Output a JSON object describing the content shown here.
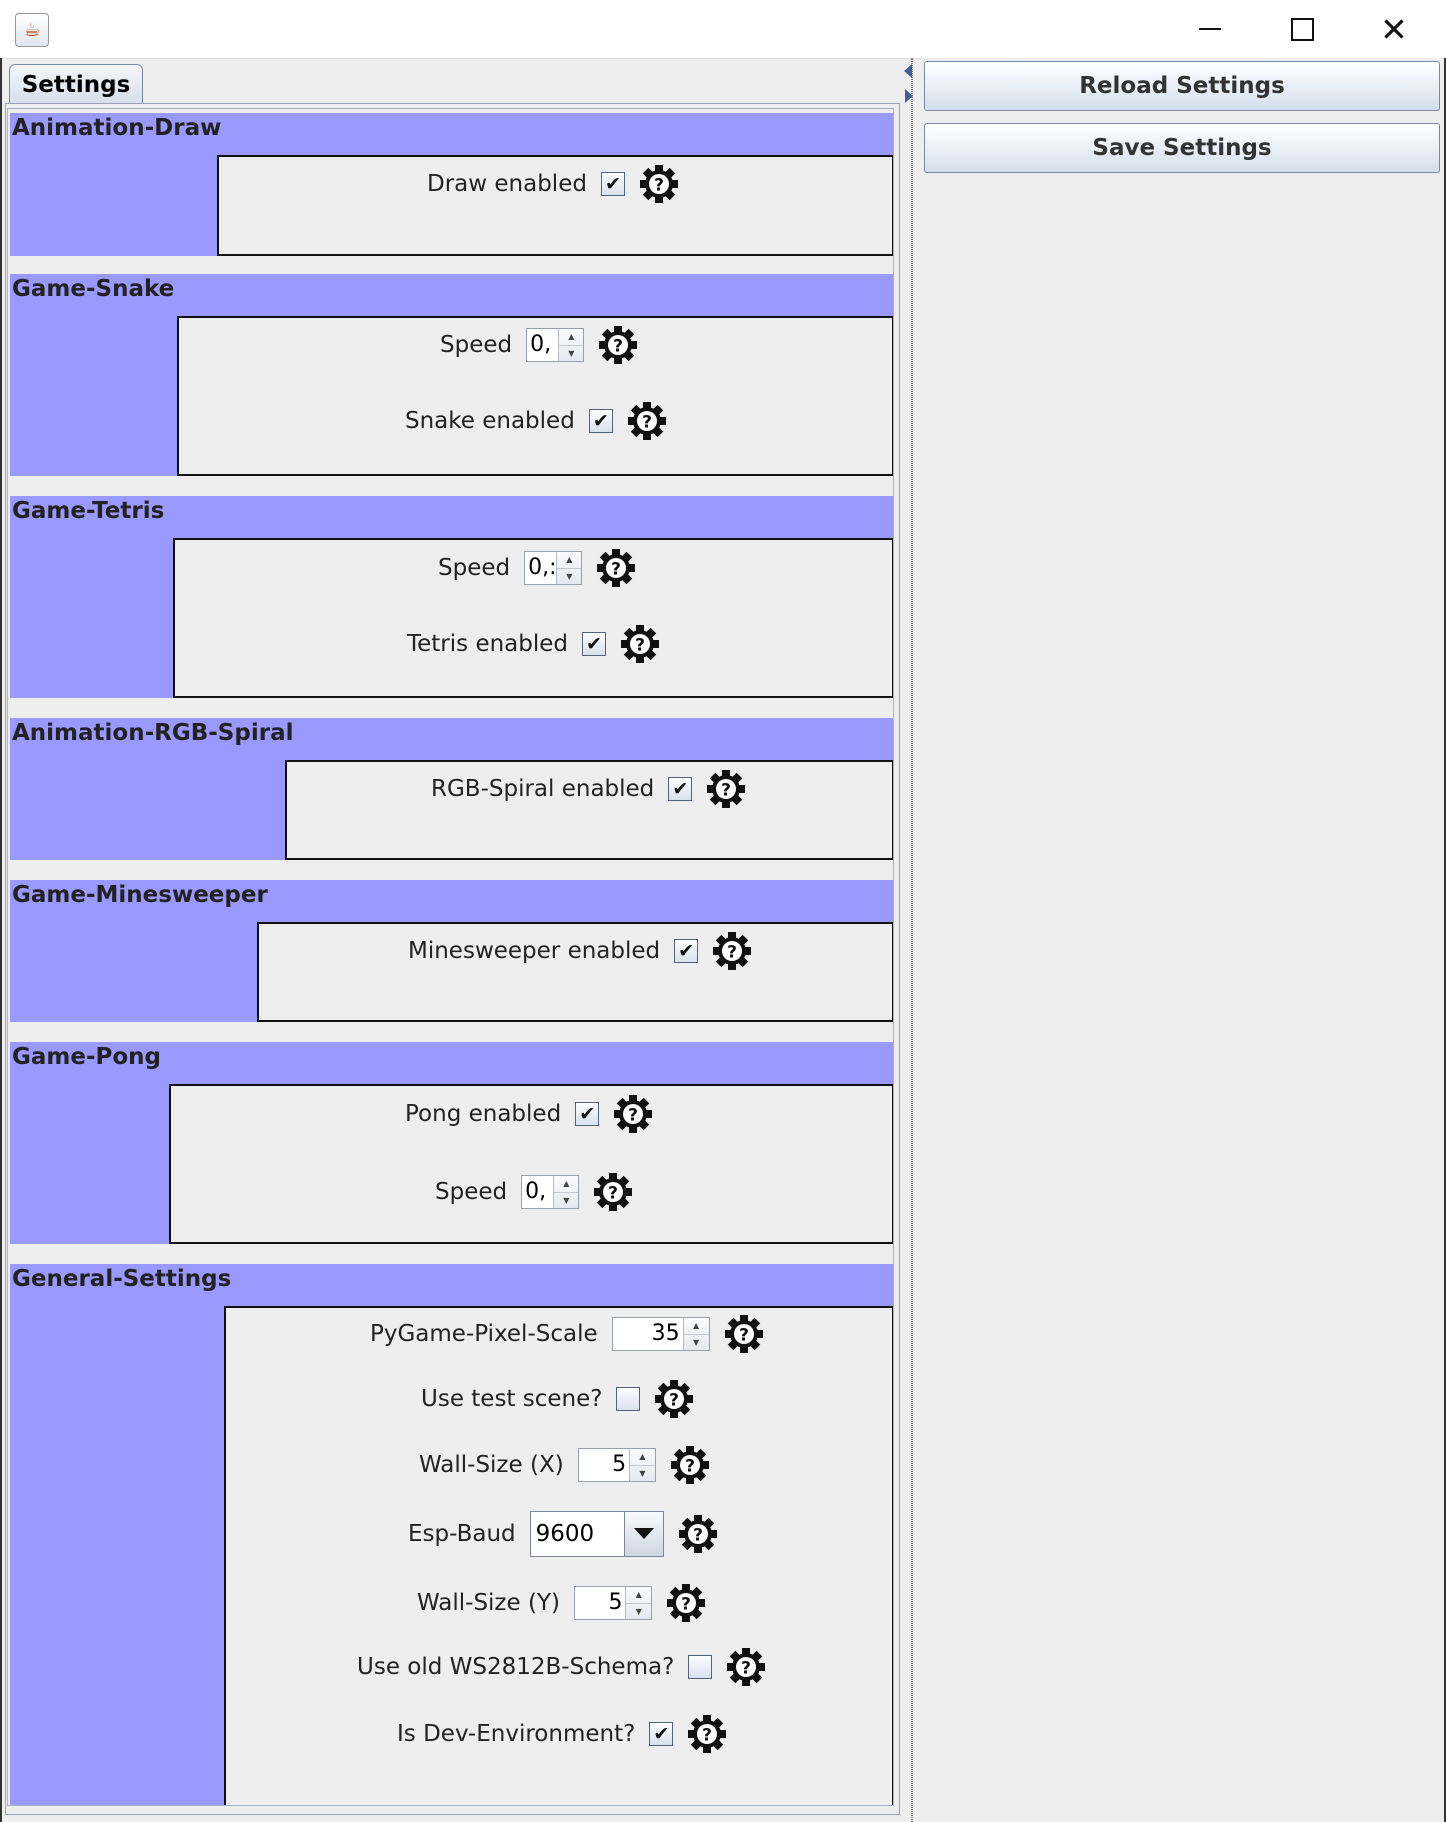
{
  "window": {
    "app_icon": "java-coffee-cup-icon",
    "controls": {
      "minimize": "minimize-icon",
      "maximize": "maximize-icon",
      "close": "close-icon"
    }
  },
  "tabs": [
    {
      "label": "Settings",
      "selected": true
    }
  ],
  "actions": {
    "reload_label": "Reload Settings",
    "save_label": "Save Settings"
  },
  "colors": {
    "section_header": "#9999ff",
    "panel_background": "#eeeeee"
  },
  "sections": [
    {
      "title": "Animation-Draw",
      "rows": [
        {
          "type": "checkbox",
          "label": "Draw enabled",
          "checked": true
        }
      ]
    },
    {
      "title": "Game-Snake",
      "rows": [
        {
          "type": "spinner",
          "label": "Speed",
          "value": "0,"
        },
        {
          "type": "checkbox",
          "label": "Snake enabled",
          "checked": true
        }
      ]
    },
    {
      "title": "Game-Tetris",
      "rows": [
        {
          "type": "spinner",
          "label": "Speed",
          "value": "0,:"
        },
        {
          "type": "checkbox",
          "label": "Tetris enabled",
          "checked": true
        }
      ]
    },
    {
      "title": "Animation-RGB-Spiral",
      "rows": [
        {
          "type": "checkbox",
          "label": "RGB-Spiral enabled",
          "checked": true
        }
      ]
    },
    {
      "title": "Game-Minesweeper",
      "rows": [
        {
          "type": "checkbox",
          "label": "Minesweeper enabled",
          "checked": true
        }
      ]
    },
    {
      "title": "Game-Pong",
      "rows": [
        {
          "type": "checkbox",
          "label": "Pong enabled",
          "checked": true
        },
        {
          "type": "spinner",
          "label": "Speed",
          "value": "0,"
        }
      ]
    },
    {
      "title": "General-Settings",
      "rows": [
        {
          "type": "spinner",
          "label": "PyGame-Pixel-Scale",
          "value": "35"
        },
        {
          "type": "checkbox",
          "label": "Use test scene?",
          "checked": false
        },
        {
          "type": "spinner",
          "label": "Wall-Size (X)",
          "value": "5"
        },
        {
          "type": "combo",
          "label": "Esp-Baud",
          "value": "9600"
        },
        {
          "type": "spinner",
          "label": "Wall-Size (Y)",
          "value": "5"
        },
        {
          "type": "checkbox",
          "label": "Use old WS2812B-Schema?",
          "checked": false
        },
        {
          "type": "checkbox",
          "label": "Is Dev-Environment?",
          "checked": true
        }
      ]
    }
  ],
  "help_icon": "help-gear-icon",
  "check_mark": "✔"
}
